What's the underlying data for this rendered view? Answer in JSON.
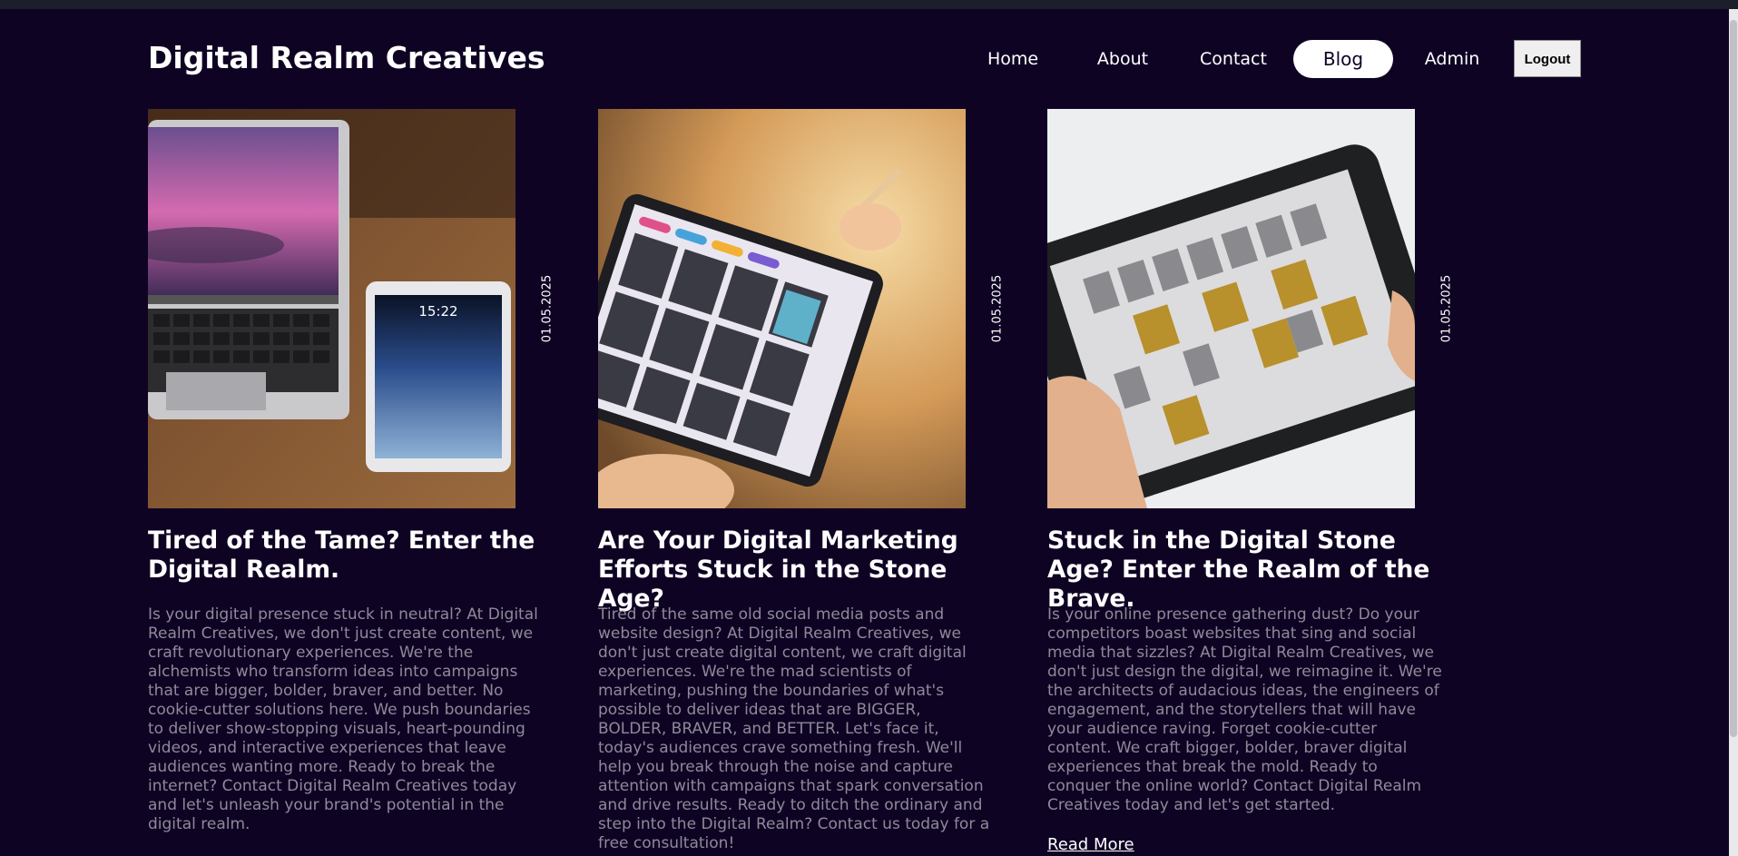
{
  "site": {
    "logo": "Digital Realm Creatives"
  },
  "nav": {
    "items": [
      {
        "label": "Home"
      },
      {
        "label": "About"
      },
      {
        "label": "Contact"
      },
      {
        "label": "Blog",
        "active": true
      },
      {
        "label": "Admin"
      }
    ],
    "logout_label": "Logout"
  },
  "posts": [
    {
      "date": "01.05.2025",
      "title": "Tired of the Tame? Enter the Digital Realm.",
      "excerpt": "Is your digital presence stuck in neutral? At Digital Realm Creatives, we don't just create content, we craft revolutionary experiences. We're the alchemists who transform ideas into campaigns that are bigger, bolder, braver, and better. No cookie-cutter solutions here. We push boundaries to deliver show-stopping visuals, heart-pounding videos, and interactive experiences that leave audiences wanting more. Ready to break the internet? Contact Digital Realm Creatives today and let's unleash your brand's potential in the digital realm."
    },
    {
      "date": "01.05.2025",
      "title": "Are Your Digital Marketing Efforts Stuck in the Stone Age?",
      "excerpt": "Tired of the same old social media posts and website design? At Digital Realm Creatives, we don't just create digital content, we craft digital experiences. We're the mad scientists of marketing, pushing the boundaries of what's possible to deliver ideas that are BIGGER, BOLDER, BRAVER, and BETTER. Let's face it, today's audiences crave something fresh. We'll help you break through the noise and capture attention with campaigns that spark conversation and drive results. Ready to ditch the ordinary and step into the Digital Realm? Contact us today for a free consultation!"
    },
    {
      "date": "01.05.2025",
      "title": "Stuck in the Digital Stone Age? Enter the Realm of the Brave.",
      "excerpt": "Is your online presence gathering dust? Do your competitors boast websites that sing and social media that sizzles? At Digital Realm Creatives, we don't just design the digital, we reimagine it. We're the architects of audacious ideas, the engineers of engagement, and the storytellers that will have your audience raving. Forget cookie-cutter content. We craft bigger, bolder, braver digital experiences that break the mold. Ready to conquer the online world? Contact Digital Realm Creatives today and let's get started.",
      "read_more": "Read More"
    }
  ],
  "colors": {
    "background": "#0f0324",
    "text": "#ffffff",
    "muted_text": "#8e8a99",
    "active_pill": "#ffffff"
  }
}
